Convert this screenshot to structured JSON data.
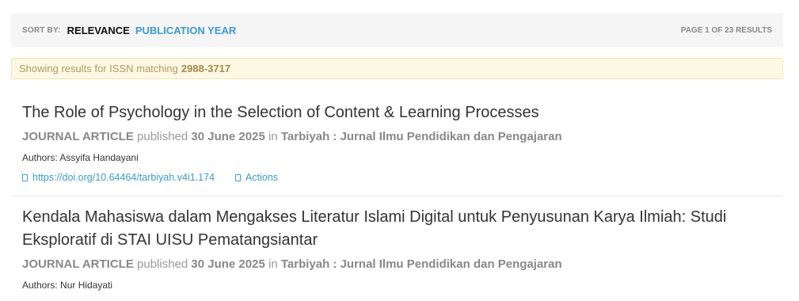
{
  "sort": {
    "label": "SORT BY:",
    "options": [
      "RELEVANCE",
      "PUBLICATION YEAR"
    ],
    "page_info": "PAGE 1 OF 23 RESULTS"
  },
  "notice": {
    "text": "Showing results for ISSN matching",
    "issn": "2988-3717"
  },
  "results": [
    {
      "title": "The Role of Psychology in the Selection of Content & Learning Processes",
      "type": "JOURNAL ARTICLE",
      "published_word": "published",
      "date": "30 June 2025",
      "in_word": "in",
      "journal": "Tarbiyah : Jurnal Ilmu Pendidikan dan Pengajaran",
      "authors": "Authors: Assyifa Handayani",
      "doi": "https://doi.org/10.64464/tarbiyah.v4i1.174",
      "actions": "Actions"
    },
    {
      "title": "Kendala Mahasiswa dalam Mengakses Literatur Islami Digital untuk Penyusunan Karya Ilmiah: Studi Eksploratif di STAI UISU Pematangsiantar",
      "type": "JOURNAL ARTICLE",
      "published_word": "published",
      "date": "30 June 2025",
      "in_word": "in",
      "journal": "Tarbiyah : Jurnal Ilmu Pendidikan dan Pengajaran",
      "authors": "Authors: Nur Hidayati"
    }
  ]
}
